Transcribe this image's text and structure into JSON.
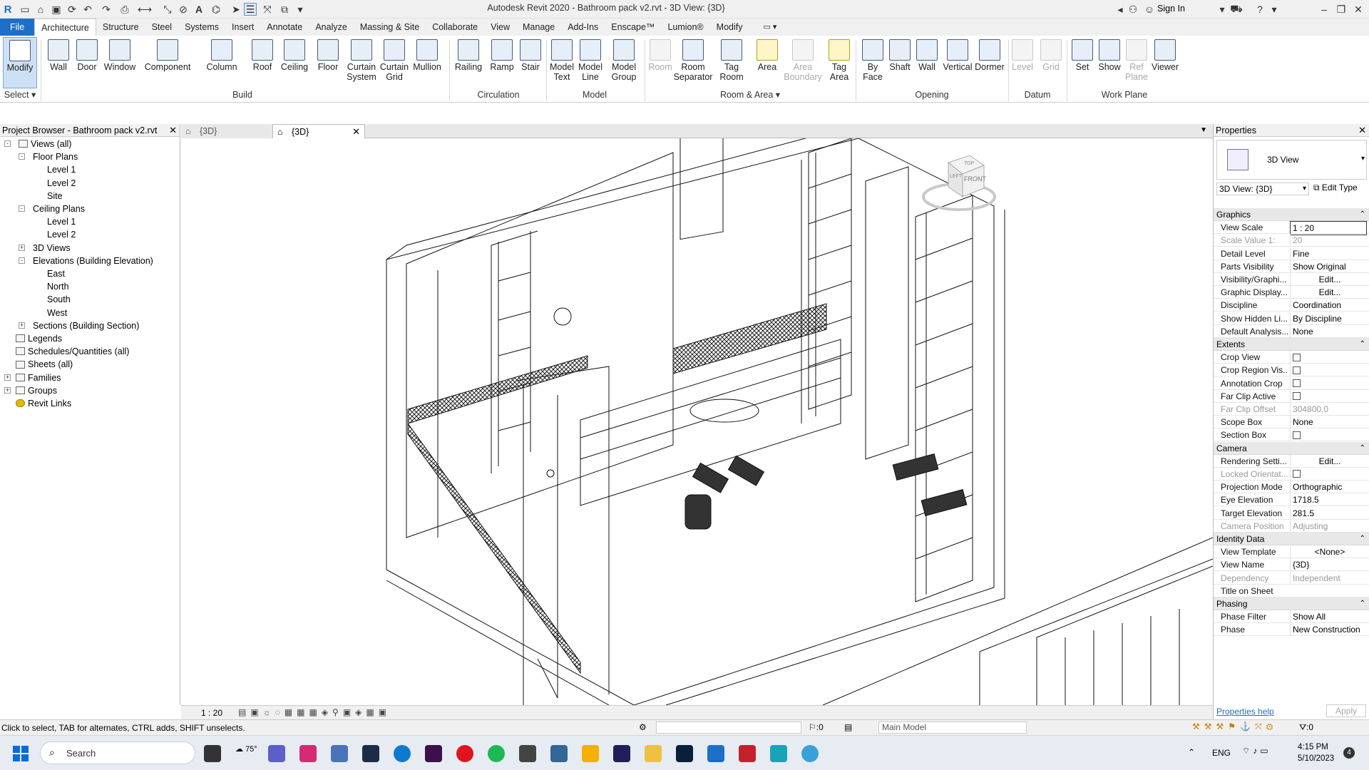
{
  "app": {
    "title": "Autodesk Revit 2020 - Bathroom pack v2.rvt - 3D View: {3D}",
    "sign_in": "Sign In",
    "colors": {
      "accent": "#1e6fc8",
      "ribbon_bg": "#f0f0f0",
      "selection": "#cde0f5"
    }
  },
  "ribbon_tabs": [
    "File",
    "Architecture",
    "Structure",
    "Steel",
    "Systems",
    "Insert",
    "Annotate",
    "Analyze",
    "Massing & Site",
    "Collaborate",
    "View",
    "Manage",
    "Add-Ins",
    "Enscape™",
    "Lumion®",
    "Modify"
  ],
  "ribbon": {
    "select": {
      "label": "Modify",
      "panel": "Select"
    },
    "build": {
      "panel": "Build",
      "items": [
        "Wall",
        "Door",
        "Window",
        "Component",
        "Column",
        "Roof",
        "Ceiling",
        "Floor",
        "Curtain System",
        "Curtain Grid",
        "Mullion"
      ]
    },
    "circulation": {
      "panel": "Circulation",
      "items": [
        "Railing",
        "Ramp",
        "Stair"
      ]
    },
    "model": {
      "panel": "Model",
      "items": [
        "Model Text",
        "Model Line",
        "Model Group"
      ]
    },
    "room_area": {
      "panel": "Room & Area",
      "items": [
        "Room",
        "Room Separator",
        "Tag Room",
        "Area",
        "Area Boundary",
        "Tag Area"
      ]
    },
    "opening": {
      "panel": "Opening",
      "items": [
        "By Face",
        "Shaft",
        "Wall",
        "Vertical",
        "Dormer"
      ]
    },
    "datum": {
      "panel": "Datum",
      "items": [
        "Level",
        "Grid"
      ]
    },
    "work_plane": {
      "panel": "Work Plane",
      "items": [
        "Set",
        "Show",
        "Ref Plane",
        "Viewer"
      ]
    }
  },
  "project_browser": {
    "title": "Project Browser - Bathroom pack v2.rvt",
    "tree": [
      {
        "label": "Views (all)"
      },
      {
        "label": "Floor Plans"
      },
      {
        "label": "Level 1"
      },
      {
        "label": "Level 2"
      },
      {
        "label": "Site"
      },
      {
        "label": "Ceiling Plans"
      },
      {
        "label": "Level 1"
      },
      {
        "label": "Level 2"
      },
      {
        "label": "3D Views"
      },
      {
        "label": "Elevations (Building Elevation)"
      },
      {
        "label": "East"
      },
      {
        "label": "North"
      },
      {
        "label": "South"
      },
      {
        "label": "West"
      },
      {
        "label": "Sections (Building Section)"
      },
      {
        "label": "Legends"
      },
      {
        "label": "Schedules/Quantities (all)"
      },
      {
        "label": "Sheets (all)"
      },
      {
        "label": "Families"
      },
      {
        "label": "Groups"
      },
      {
        "label": "Revit Links"
      }
    ]
  },
  "view_tabs": [
    {
      "label": "{3D}"
    },
    {
      "label": "{3D}"
    }
  ],
  "view_control": {
    "scale": "1 : 20"
  },
  "viewcube": {
    "top": "TOP",
    "front": "FRONT",
    "left": "LEFT"
  },
  "properties": {
    "title": "Properties",
    "type_name": "3D View",
    "selector": "3D View: {3D}",
    "edit_type": "Edit Type",
    "sections": [
      {
        "name": "Graphics",
        "rows": [
          {
            "k": "View Scale",
            "v": "1 : 20"
          },
          {
            "k": "Scale Value    1:",
            "v": "20"
          },
          {
            "k": "Detail Level",
            "v": "Fine"
          },
          {
            "k": "Parts Visibility",
            "v": "Show Original"
          },
          {
            "k": "Visibility/Graphi...",
            "v": "Edit..."
          },
          {
            "k": "Graphic Display...",
            "v": "Edit..."
          },
          {
            "k": "Discipline",
            "v": "Coordination"
          },
          {
            "k": "Show Hidden Li...",
            "v": "By Discipline"
          },
          {
            "k": "Default Analysis...",
            "v": "None"
          }
        ]
      },
      {
        "name": "Extents",
        "rows": [
          {
            "k": "Crop View",
            "v": ""
          },
          {
            "k": "Crop Region Vis...",
            "v": ""
          },
          {
            "k": "Annotation Crop",
            "v": ""
          },
          {
            "k": "Far Clip Active",
            "v": ""
          },
          {
            "k": "Far Clip Offset",
            "v": "304800.0"
          },
          {
            "k": "Scope Box",
            "v": "None"
          },
          {
            "k": "Section Box",
            "v": ""
          }
        ]
      },
      {
        "name": "Camera",
        "rows": [
          {
            "k": "Rendering Setti...",
            "v": "Edit..."
          },
          {
            "k": "Locked Orientat...",
            "v": ""
          },
          {
            "k": "Projection Mode",
            "v": "Orthographic"
          },
          {
            "k": "Eye Elevation",
            "v": "1718.5"
          },
          {
            "k": "Target Elevation",
            "v": "281.5"
          },
          {
            "k": "Camera Position",
            "v": "Adjusting"
          }
        ]
      },
      {
        "name": "Identity Data",
        "rows": [
          {
            "k": "View Template",
            "v": "<None>"
          },
          {
            "k": "View Name",
            "v": "{3D}"
          },
          {
            "k": "Dependency",
            "v": "Independent"
          },
          {
            "k": "Title on Sheet",
            "v": ""
          }
        ]
      },
      {
        "name": "Phasing",
        "rows": [
          {
            "k": "Phase Filter",
            "v": "Show All"
          },
          {
            "k": "Phase",
            "v": "New Construction"
          }
        ]
      }
    ],
    "help": "Properties help",
    "apply": "Apply"
  },
  "status": {
    "hint": "Click to select, TAB for alternates, CTRL adds, SHIFT unselects.",
    "worksets": ":0",
    "model": "Main Model",
    "filter": ":0"
  },
  "taskbar": {
    "search": "Search",
    "weather": "75°",
    "lang": "ENG",
    "time": "4:15 PM",
    "date": "5/10/2023",
    "notif": "4"
  }
}
